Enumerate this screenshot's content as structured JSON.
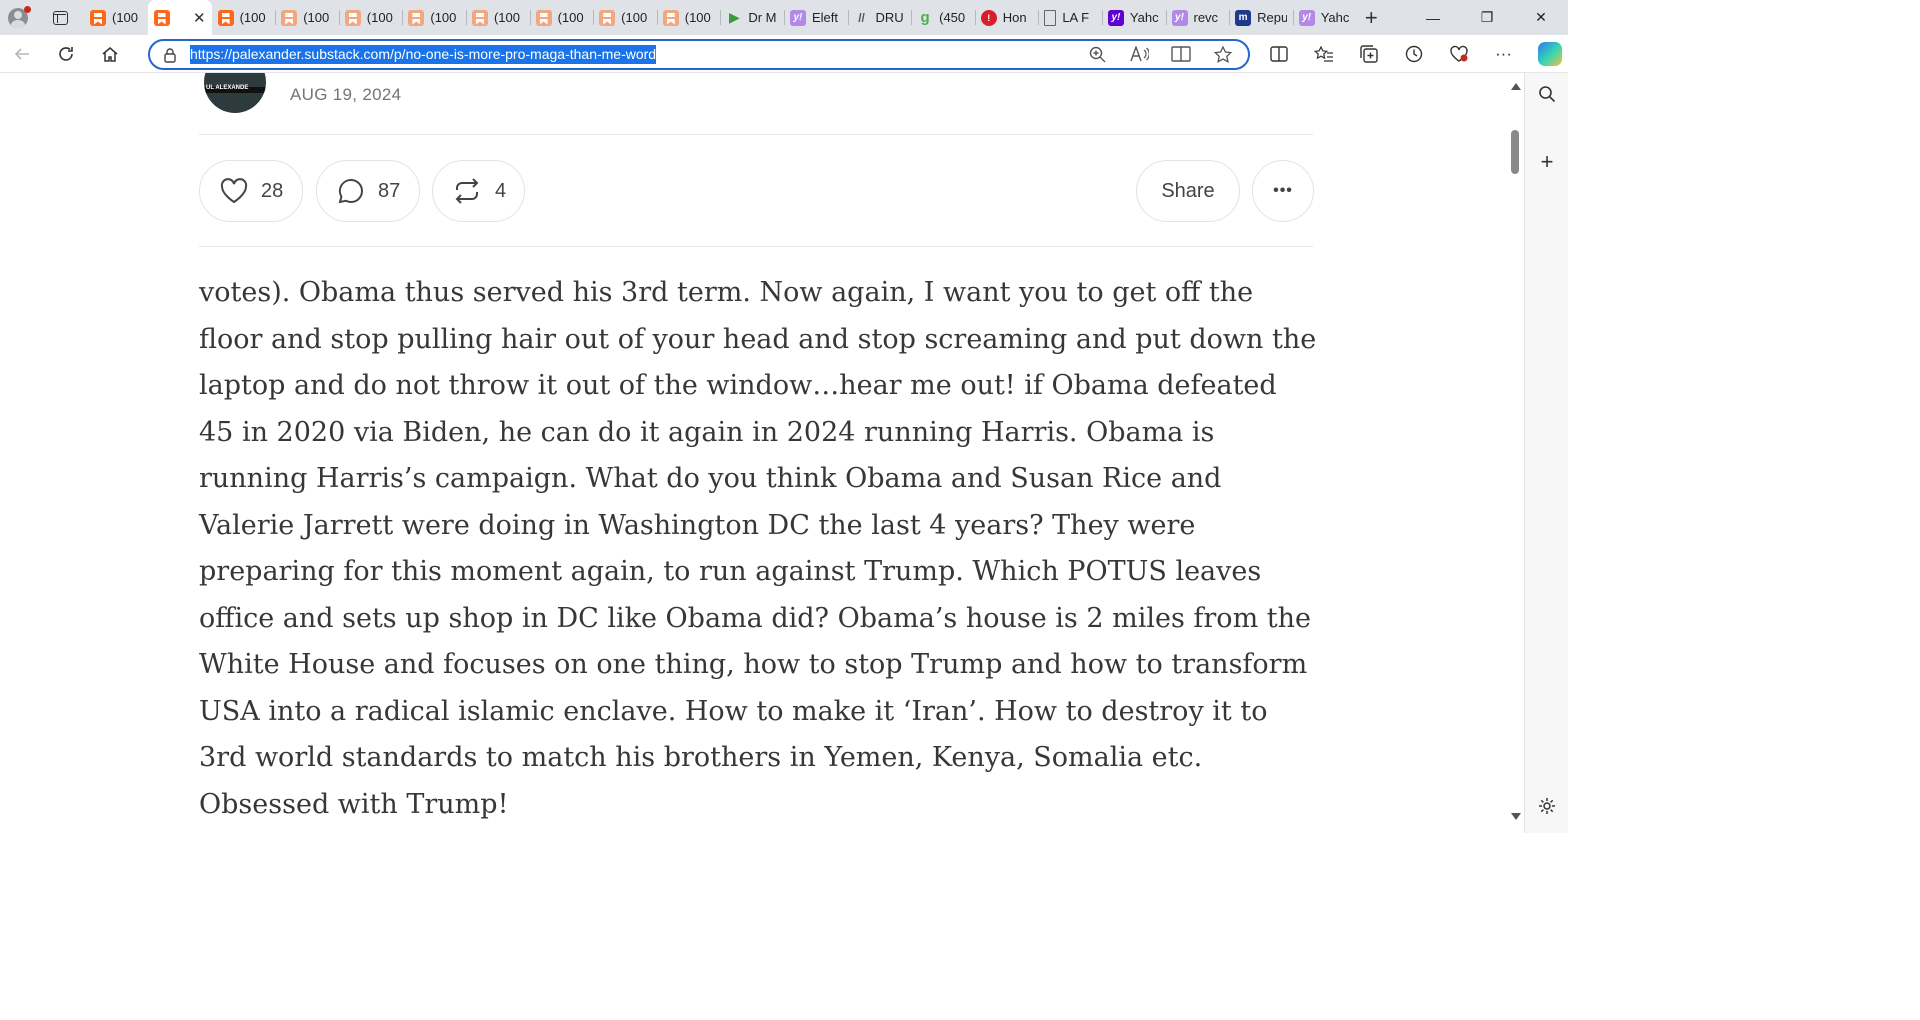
{
  "browser": {
    "tabs": [
      {
        "title": "(100",
        "icon": "substack-icon"
      },
      {
        "title": "",
        "icon": "substack-icon",
        "active": true
      },
      {
        "title": "(100",
        "icon": "substack-icon"
      },
      {
        "title": "(100",
        "icon": "substack-icon"
      },
      {
        "title": "(100",
        "icon": "substack-icon"
      },
      {
        "title": "(100",
        "icon": "substack-icon"
      },
      {
        "title": "(100",
        "icon": "substack-icon"
      },
      {
        "title": "(100",
        "icon": "substack-icon"
      },
      {
        "title": "(100",
        "icon": "substack-icon"
      },
      {
        "title": "(100",
        "icon": "substack-icon"
      },
      {
        "title": "Dr M",
        "icon": "play-icon"
      },
      {
        "title": "Eleft",
        "icon": "yahoo-icon"
      },
      {
        "title": "DRU",
        "icon": "drudge-icon"
      },
      {
        "title": "(450",
        "icon": "green-g-icon"
      },
      {
        "title": "Hon",
        "icon": "red-icon"
      },
      {
        "title": "LA F",
        "icon": "document-icon"
      },
      {
        "title": "Yahc",
        "icon": "yahoo-icon"
      },
      {
        "title": "revc",
        "icon": "yahoo-icon"
      },
      {
        "title": "Repu",
        "icon": "m-icon"
      },
      {
        "title": "Yahc",
        "icon": "yahoo-icon"
      }
    ],
    "close_glyph": "✕",
    "new_tab_glyph": "+",
    "url": "https://palexander.substack.com/p/no-one-is-more-pro-maga-than-me-word"
  },
  "post": {
    "avatar_text": "UL ALEXANDE",
    "date": "AUG 19, 2024",
    "likes": "28",
    "comments": "87",
    "restacks": "4",
    "share_label": "Share",
    "more_label": "•••",
    "paragraph_1": "votes). Obama thus served his 3rd term. Now again, I want you to get off the floor and stop pulling hair out of your head and stop screaming and put down the laptop and do not throw it out of the window…hear me out! if Obama defeated 45 in 2020 via Biden, he can do it again in 2024 running Harris. Obama is running Harris’s campaign. What do you think Obama and Susan Rice and Valerie Jarrett were doing in Washington DC the last 4 years? They were preparing for this moment again, to run against Trump. Which POTUS leaves office and sets up shop in DC like Obama did? Obama’s house is 2 miles from the White House and focuses on one thing, how to stop Trump and how to transform USA into a radical islamic enclave. How to make it ‘Iran’. How to destroy it to 3rd world standards to match his brothers in Yemen, Kenya, Somalia etc. Obsessed with Trump!"
  },
  "colors": {
    "tab_strip": "#dfe3e8",
    "url_highlight": "#1a73e8",
    "substack_orange": "#ff6719",
    "text": "#363737"
  }
}
